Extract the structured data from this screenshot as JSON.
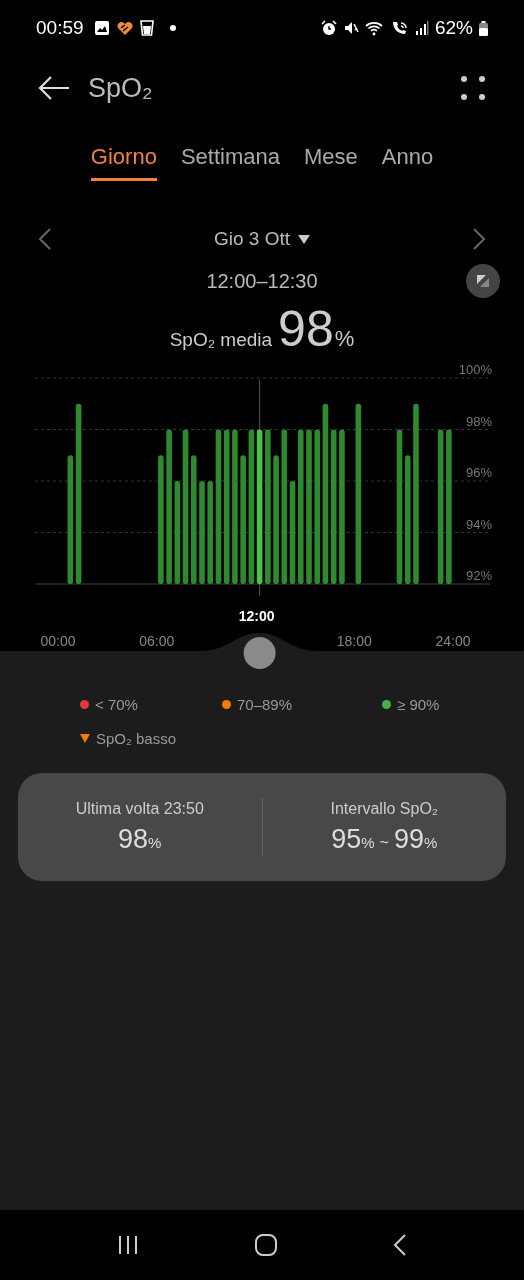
{
  "status_bar": {
    "time": "00:59",
    "battery": "62%"
  },
  "header": {
    "title": "SpO₂"
  },
  "tabs": [
    {
      "label": "Giorno",
      "selected": true
    },
    {
      "label": "Settimana",
      "selected": false
    },
    {
      "label": "Mese",
      "selected": false
    },
    {
      "label": "Anno",
      "selected": false
    }
  ],
  "date": {
    "label": "Gio 3 Ott"
  },
  "time_range": "12:00–12:30",
  "average": {
    "label": "SpO₂ media",
    "value": "98",
    "unit": "%"
  },
  "chart": {
    "selection": {
      "label": "12:00"
    },
    "chart_data": {
      "type": "bar",
      "grid": true,
      "ref_lines": [
        {
          "axis": "x",
          "value": 12.25,
          "color": "#555555"
        }
      ],
      "x": [
        0.5,
        1,
        6,
        6.5,
        7,
        7.5,
        8,
        8.5,
        9,
        9.5,
        10,
        10.5,
        11,
        11.5,
        12,
        12.5,
        13,
        13.5,
        14,
        14.5,
        15,
        15.5,
        16,
        16.5,
        17,
        18,
        20.5,
        21,
        21.5,
        23,
        23.5
      ],
      "series": [
        {
          "color": "#2f8a2f",
          "values": [
            97,
            99,
            97,
            98,
            96,
            98,
            97,
            96,
            96,
            98,
            98,
            98,
            97,
            98,
            null,
            98,
            97,
            98,
            96,
            98,
            98,
            98,
            99,
            98,
            98,
            99,
            98,
            97,
            99,
            98,
            98
          ]
        },
        {
          "color": "#4cc24a",
          "values": [
            null,
            null,
            null,
            null,
            null,
            null,
            null,
            null,
            null,
            null,
            null,
            null,
            null,
            null,
            98,
            null,
            null,
            null,
            null,
            null,
            null,
            null,
            null,
            null,
            null,
            null,
            null,
            null,
            null,
            null,
            null
          ]
        }
      ],
      "xlim": [
        0,
        24
      ],
      "ylim": [
        92,
        100
      ],
      "xticks": [
        {
          "value": 0,
          "label": "00:00"
        },
        {
          "value": 6,
          "label": "06:00"
        },
        {
          "value": 18,
          "label": "18:00"
        },
        {
          "value": 24,
          "label": "24:00"
        }
      ],
      "yticks": [
        {
          "value": 92,
          "label": "92%"
        },
        {
          "value": 94,
          "label": "94%"
        },
        {
          "value": 96,
          "label": "96%"
        },
        {
          "value": 98,
          "label": "98%"
        },
        {
          "value": 100,
          "label": "100%"
        }
      ]
    }
  },
  "legend": [
    {
      "kind": "dot",
      "label": "< 70%",
      "color": "#e53935"
    },
    {
      "kind": "dot",
      "label": "70–89%",
      "color": "#f57c00"
    },
    {
      "kind": "dot",
      "label": "≥ 90%",
      "color": "#43b047"
    },
    {
      "kind": "triangle",
      "label": "SpO₂ basso",
      "color": "#f57c00"
    }
  ],
  "summary": [
    {
      "kind": "single",
      "label": "Ultima volta 23:50",
      "value": "98",
      "unit": "%"
    },
    {
      "kind": "range",
      "label": "Intervallo SpO₂",
      "min": "95",
      "max": "99",
      "unit": "%",
      "separator": "~"
    }
  ]
}
